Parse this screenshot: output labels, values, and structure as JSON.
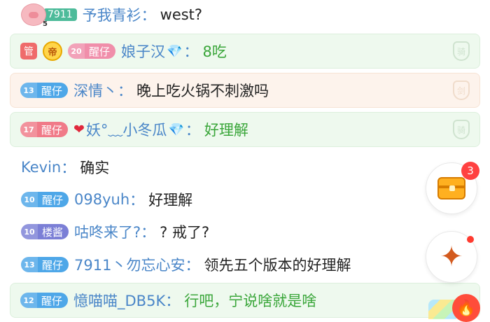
{
  "messages": [
    {
      "user": "予我青衫",
      "text": "west?",
      "fan_level": "5",
      "fan_tag": "7911"
    },
    {
      "guard_label": "管",
      "noble_label": "帝",
      "badge_level": "20",
      "badge_name": "醒仔",
      "user": "娘子汉",
      "text": "8吃",
      "shield": "骑"
    },
    {
      "badge_level": "13",
      "badge_name": "醒仔",
      "user": "深情丶",
      "text": "晚上吃火锅不刺激吗",
      "shield": "剑"
    },
    {
      "badge_level": "17",
      "badge_name": "醒仔",
      "user": "妖°﹏小冬瓜",
      "text": "好理解",
      "shield": "骑"
    },
    {
      "user": "Kevin",
      "text": "确实"
    },
    {
      "badge_level": "10",
      "badge_name": "醒仔",
      "user": "098yuh",
      "text": "好理解"
    },
    {
      "badge_level": "10",
      "badge_name": "楼酱",
      "user": "咕咚来了?",
      "text": "? 戒了?"
    },
    {
      "badge_level": "13",
      "badge_name": "醒仔",
      "user": "7911丶勿忘心安",
      "text": "领先五个版本的好理解"
    },
    {
      "badge_level": "12",
      "badge_name": "醒仔",
      "user": "憶喵喵_DB5K",
      "text": "行吧，宁说啥就是啥"
    }
  ],
  "colon": "：",
  "floating": {
    "treasure_badge": "3"
  },
  "icons": {
    "gem": "💎",
    "heart": "❤",
    "fire": "🔥",
    "star": "✦"
  },
  "colors": {
    "name": "#4a86c8",
    "green_text": "#3aa63a",
    "badge_blue": "#4ea7e8",
    "badge_red": "#f07a88",
    "notif_red": "#ff4141"
  }
}
